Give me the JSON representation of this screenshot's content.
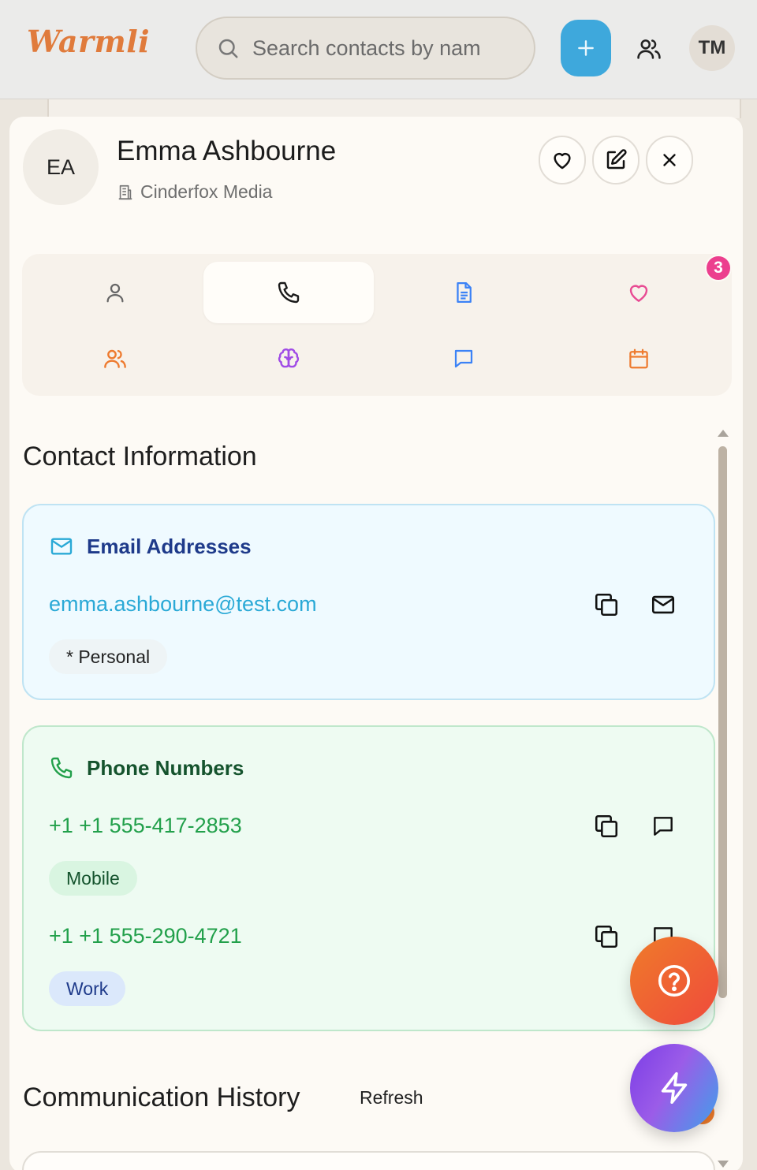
{
  "app": {
    "logo": "Warmli"
  },
  "topbar": {
    "search_placeholder": "Search contacts by nam",
    "user_initials": "TM"
  },
  "contact": {
    "initials": "EA",
    "name": "Emma Ashbourne",
    "company": "Cinderfox Media"
  },
  "tabs": {
    "items": [
      "user-icon",
      "phone-icon",
      "document-icon",
      "heart-icon",
      "users-icon",
      "brain-icon",
      "message-icon",
      "calendar-icon"
    ],
    "active": "phone-icon",
    "badge": "3"
  },
  "contact_info": {
    "title": "Contact Information",
    "email": {
      "heading": "Email Addresses",
      "value": "emma.ashbourne@test.com",
      "tag": "* Personal"
    },
    "phone": {
      "heading": "Phone Numbers",
      "numbers": [
        {
          "value": "+1 +1 555-417-2853",
          "tag": "Mobile"
        },
        {
          "value": "+1 +1 555-290-4721",
          "tag": "Work"
        }
      ]
    }
  },
  "communication": {
    "title": "Communication History",
    "refresh_label": "Refresh"
  },
  "colors": {
    "brand": "#e07b3c",
    "add_button": "#3ea8dc",
    "email_accent": "#2aa9d6",
    "email_heading": "#1e3a8a",
    "phone_accent": "#22a04b",
    "phone_heading": "#14532d",
    "badge": "#ec3f8e"
  }
}
